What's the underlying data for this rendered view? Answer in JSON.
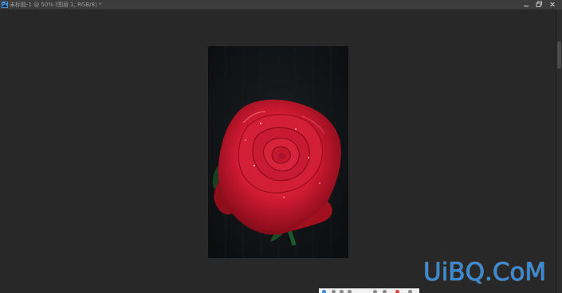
{
  "window": {
    "title": "未标题-1 @ 50% (图层 1, RGB/8) *",
    "app_icon_label": "Ps"
  },
  "controls": {
    "minimize_icon": "minimize-icon",
    "restore_icon": "restore-icon",
    "close_icon": "close-icon"
  },
  "canvas": {
    "image": "red-rose-on-dark-background"
  },
  "watermark": {
    "text": "UiBQ.CoM"
  },
  "colors": {
    "workspace": "#282828",
    "titlebar": "#3c3c3c",
    "rose": "#c8162d",
    "watermark": "#2f8be0"
  }
}
